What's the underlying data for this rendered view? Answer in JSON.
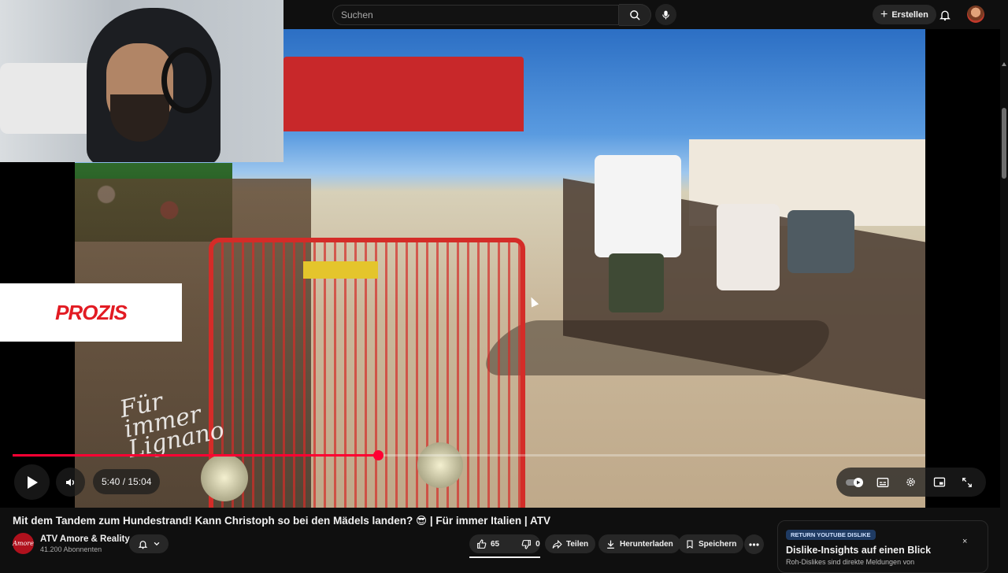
{
  "header": {
    "search_placeholder": "Suchen",
    "create_label": "Erstellen"
  },
  "player": {
    "time_display": "5:40 / 15:04",
    "progress_fraction": 0.4,
    "ad_overlay_text": "PROZIS",
    "watermark_text": "Für immer Lignano"
  },
  "video": {
    "title": "Mit dem Tandem zum Hundestrand! Kann Christoph so bei den Mädels landen? 😎 | Für immer Italien | ATV",
    "channel_name": "ATV Amore & Reality",
    "channel_avatar_text": "Amore",
    "subscribers": "41.200 Abonnenten",
    "likes": "65",
    "dislikes": "0",
    "share_label": "Teilen",
    "download_label": "Herunterladen",
    "save_label": "Speichern"
  },
  "dislike_card": {
    "badge": "RETURN YOUTUBE DISLIKE",
    "title": "Dislike-Insights auf einen Blick",
    "subtitle": "Roh-Dislikes sind direkte Meldungen von",
    "close_symbol": "×"
  },
  "colors": {
    "accent": "#ff0033",
    "background": "#0f0f0f",
    "prozis_red": "#e21b23"
  }
}
